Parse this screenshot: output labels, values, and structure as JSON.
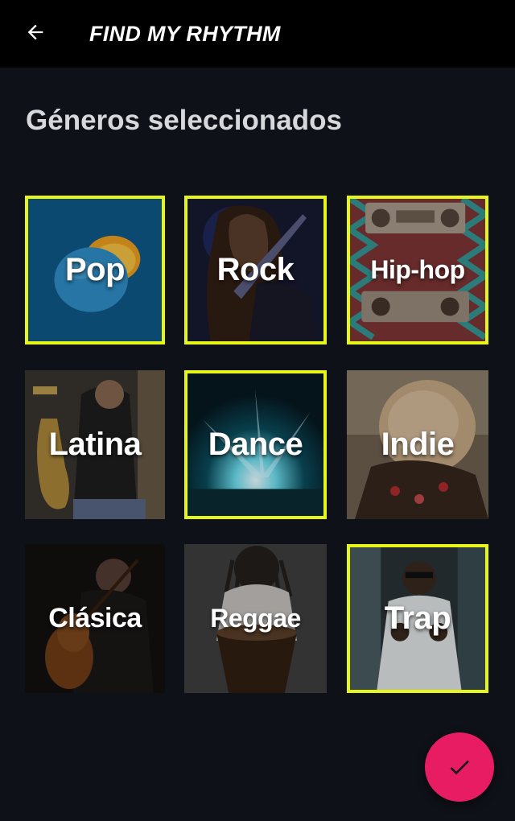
{
  "appbar": {
    "title": "FIND MY RHYTHM",
    "back_icon": "arrow-left-icon"
  },
  "section_title": "Géneros seleccionados",
  "colors": {
    "selected_border": "#e6f51a",
    "fab": "#e81c63",
    "background": "#0f1118",
    "appbar": "#000000"
  },
  "genres": [
    {
      "label": "Pop",
      "selected": true
    },
    {
      "label": "Rock",
      "selected": true
    },
    {
      "label": "Hip-hop",
      "selected": true
    },
    {
      "label": "Latina",
      "selected": false
    },
    {
      "label": "Dance",
      "selected": true
    },
    {
      "label": "Indie",
      "selected": false
    },
    {
      "label": "Clásica",
      "selected": false
    },
    {
      "label": "Reggae",
      "selected": false
    },
    {
      "label": "Trap",
      "selected": true
    }
  ],
  "fab": {
    "icon": "check-icon"
  }
}
